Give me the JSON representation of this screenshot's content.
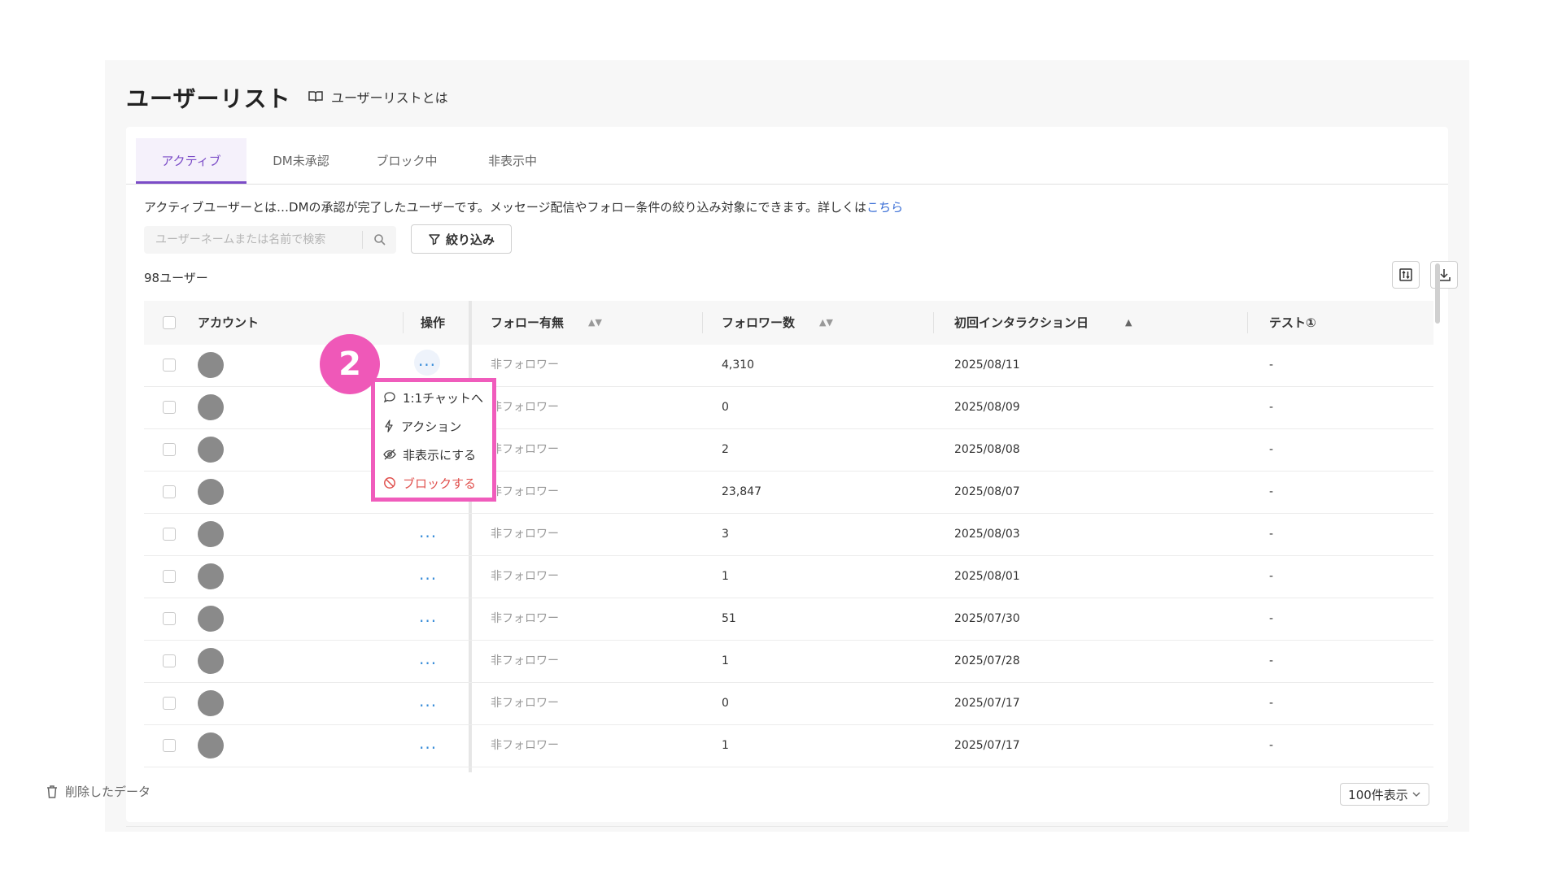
{
  "page": {
    "title": "ユーザーリスト",
    "help_link": "ユーザーリストとは"
  },
  "tabs": [
    {
      "label": "アクティブ",
      "active": true
    },
    {
      "label": "DM未承認",
      "active": false
    },
    {
      "label": "ブロック中",
      "active": false
    },
    {
      "label": "非表示中",
      "active": false
    }
  ],
  "description": {
    "text": "アクティブユーザーとは…DMの承認が完了したユーザーです。メッセージ配信やフォロー条件の絞り込み対象にできます。詳しくは",
    "link": "こちら"
  },
  "search": {
    "placeholder": "ユーザーネームまたは名前で検索",
    "value": ""
  },
  "filter_button": "絞り込み",
  "user_count": "98ユーザー",
  "table": {
    "headers": {
      "account": "アカウント",
      "actions": "操作",
      "follow_status": "フォロー有無",
      "follower_count": "フォロワー数",
      "first_interaction": "初回インタラクション日",
      "test": "テスト①"
    },
    "rows": [
      {
        "follow_status": "非フォロワー",
        "followers": "4,310",
        "date": "2025/08/11",
        "test": "-"
      },
      {
        "follow_status": "非フォロワー",
        "followers": "0",
        "date": "2025/08/09",
        "test": "-"
      },
      {
        "follow_status": "非フォロワー",
        "followers": "2",
        "date": "2025/08/08",
        "test": "-"
      },
      {
        "follow_status": "非フォロワー",
        "followers": "23,847",
        "date": "2025/08/07",
        "test": "-"
      },
      {
        "follow_status": "非フォロワー",
        "followers": "3",
        "date": "2025/08/03",
        "test": "-"
      },
      {
        "follow_status": "非フォロワー",
        "followers": "1",
        "date": "2025/08/01",
        "test": "-"
      },
      {
        "follow_status": "非フォロワー",
        "followers": "51",
        "date": "2025/07/30",
        "test": "-"
      },
      {
        "follow_status": "非フォロワー",
        "followers": "1",
        "date": "2025/07/28",
        "test": "-"
      },
      {
        "follow_status": "非フォロワー",
        "followers": "0",
        "date": "2025/07/17",
        "test": "-"
      },
      {
        "follow_status": "非フォロワー",
        "followers": "1",
        "date": "2025/07/17",
        "test": "-"
      }
    ],
    "more_icon": "..."
  },
  "context_menu": {
    "items": [
      {
        "label": "1:1チャットへ",
        "icon": "chat-icon"
      },
      {
        "label": "アクション",
        "icon": "lightning-icon"
      },
      {
        "label": "非表示にする",
        "icon": "eye-off-icon"
      },
      {
        "label": "ブロックする",
        "icon": "block-icon"
      }
    ]
  },
  "step_badge": "2",
  "footer": {
    "deleted_data": "削除したデータ",
    "page_size": "100件表示"
  },
  "colors": {
    "accent": "#7b4cc7",
    "link": "#3b6fd6",
    "highlight": "#ef58b8",
    "danger": "#e0504d"
  }
}
